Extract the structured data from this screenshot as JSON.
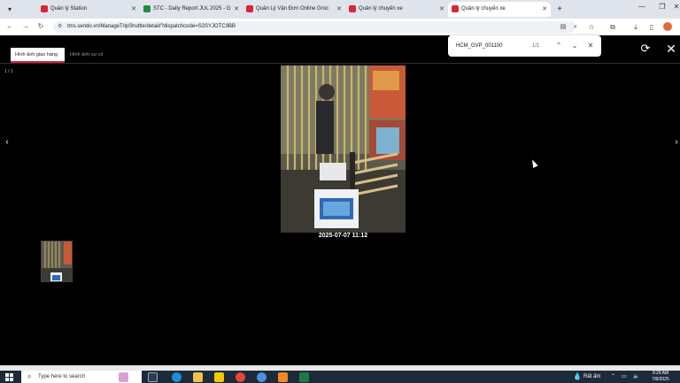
{
  "browser": {
    "tabs": [
      {
        "label": "Quản lý Station",
        "favicon_color": "#d9243a",
        "active": false
      },
      {
        "label": "STC - Daily Report JUL 2025 - G",
        "favicon_color": "#1e8e3e",
        "active": false
      },
      {
        "label": "Quản Lý Vận Đơn Online Groc",
        "favicon_color": "#d9243a",
        "active": false
      },
      {
        "label": "Quản lý chuyến xe",
        "favicon_color": "#d9243a",
        "active": false
      },
      {
        "label": "Quản lý chuyến xe",
        "favicon_color": "#d9243a",
        "active": true
      }
    ],
    "url": "tms.sendo.vn/ManageTripShuttle/detail/?dispatchcode=S2SYJOTC9BB",
    "icons": [
      "tab-menu-icon",
      "back-icon",
      "forward-icon",
      "reload-icon",
      "site-info-icon",
      "translate-icon",
      "zoom-icon",
      "star-icon",
      "extensions-icon",
      "download-icon",
      "sidebar-icon",
      "profile-avatar"
    ]
  },
  "find_bar": {
    "query": "HCM_GVP_001100",
    "count": "1/1"
  },
  "viewer": {
    "tabs": [
      {
        "label": "Hình ảnh giao hàng",
        "active": true
      },
      {
        "label": "Hình ảnh sự cố",
        "active": false
      }
    ],
    "counter": "1 / 1",
    "timestamp": "2025-07-07 11:12"
  },
  "taskbar": {
    "search_placeholder": "Type here to search",
    "weather": "Rất ấm",
    "time": "9:29 AM",
    "date": "7/8/2025",
    "accent": "#1c2a3a"
  }
}
